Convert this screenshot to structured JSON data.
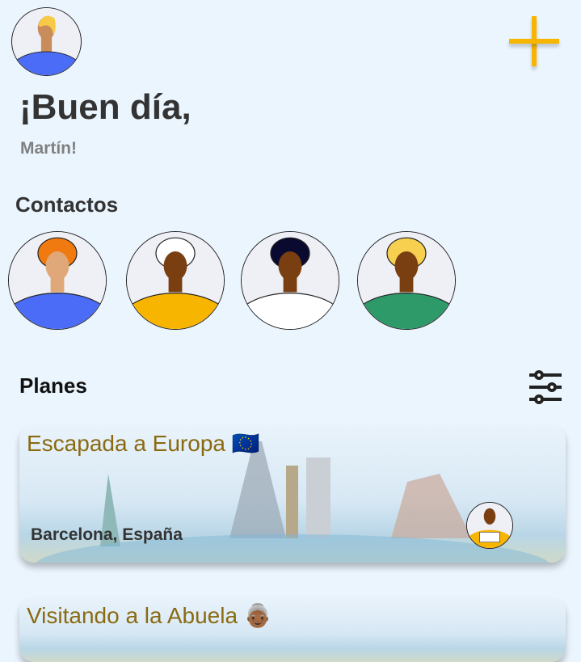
{
  "header": {
    "greeting": "¡Buen día,",
    "user_name": "Martín!",
    "add_icon": "plus-icon",
    "accent": "#f7b500"
  },
  "contacts": {
    "title": "Contactos",
    "items": [
      {
        "name": "contact-1",
        "shirt": "#4a6cf7",
        "hair": "#f07a10"
      },
      {
        "name": "contact-2",
        "shirt": "#f7b500",
        "hair": "#ffffff"
      },
      {
        "name": "contact-3",
        "shirt": "#ffffff",
        "hair": "#0a0a30"
      },
      {
        "name": "contact-4",
        "shirt": "#2e9a6a",
        "hair": "#f7d050"
      }
    ]
  },
  "plans": {
    "title": "Planes",
    "filter_icon": "sliders-icon",
    "items": [
      {
        "title": "Escapada a Europa 🇪🇺",
        "location": "Barcelona, España"
      },
      {
        "title": "Visitando a la Abuela 👵🏾",
        "location": ""
      }
    ]
  }
}
